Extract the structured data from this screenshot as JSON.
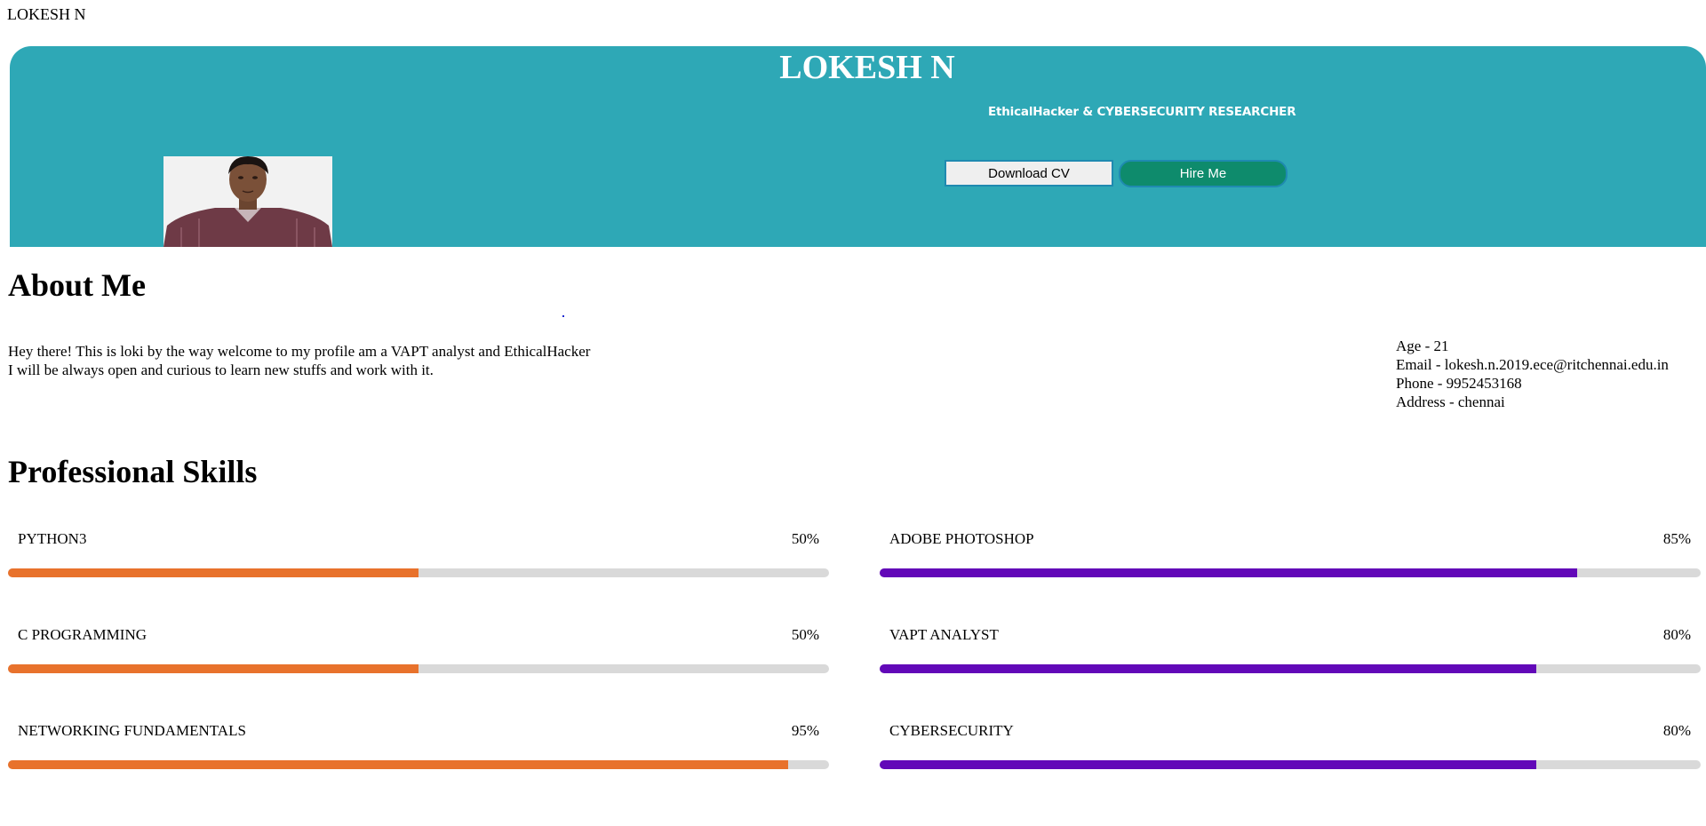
{
  "top_name": "LOKESH N",
  "hero": {
    "title": "LOKESH N",
    "subtitle": "EthicalHacker & CYBERSECURITY RESEARCHER",
    "download_label": "Download CV",
    "hire_label": "Hire Me",
    "bg_color": "#2ea8b6"
  },
  "about": {
    "heading": "About Me",
    "line1": "Hey there! This is loki by the way welcome to my profile am a VAPT analyst and EthicalHacker",
    "line2": "I will be always open and curious to learn new stuffs and work with it."
  },
  "info": {
    "age": "Age -  21",
    "email": "Email -  lokesh.n.2019.ece@ritchennai.edu.in",
    "phone": "Phone -  9952453168",
    "address": "Address - chennai"
  },
  "skills": {
    "heading": "Professional Skills",
    "left_color": "#e8722c",
    "right_color": "#6208b8",
    "left": [
      {
        "name": "PYTHON3",
        "percent_label": "50%",
        "level": 0.5
      },
      {
        "name": "C PROGRAMMING",
        "percent_label": "50%",
        "level": 0.5
      },
      {
        "name": "NETWORKING FUNDAMENTALS",
        "percent_label": "95%",
        "level": 0.95
      }
    ],
    "right": [
      {
        "name": "ADOBE PHOTOSHOP",
        "percent_label": "85%",
        "level": 0.85
      },
      {
        "name": "VAPT ANALYST",
        "percent_label": "80%",
        "level": 0.8
      },
      {
        "name": "CYBERSECURITY",
        "percent_label": "80%",
        "level": 0.8
      }
    ]
  }
}
